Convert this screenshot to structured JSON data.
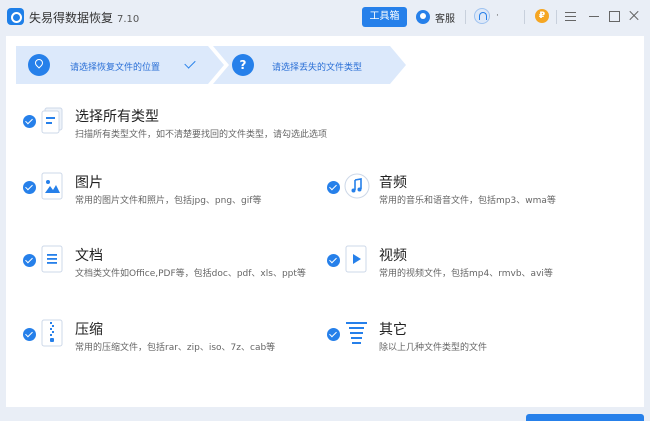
{
  "app": {
    "title": "失易得数据恢复",
    "version": "7.10"
  },
  "toolbar": {
    "toolbox_label": "工具箱",
    "service_label": "客服",
    "presence_text": "·"
  },
  "steps": [
    {
      "label": "请选择恢复文件的位置",
      "status": "done"
    },
    {
      "label": "请选择丢失的文件类型",
      "icon_text": "?"
    }
  ],
  "options": {
    "all": {
      "title": "选择所有类型",
      "desc": "扫描所有类型文件，如不清楚要找回的文件类型，请勾选此选项",
      "checked": true
    },
    "image": {
      "title": "图片",
      "desc": "常用的图片文件和照片，包括jpg、png、gif等",
      "checked": true
    },
    "audio": {
      "title": "音频",
      "desc": "常用的音乐和语音文件，包括mp3、wma等",
      "checked": true
    },
    "document": {
      "title": "文档",
      "desc": "文档类文件如Office,PDF等，包括doc、pdf、xls、ppt等",
      "checked": true
    },
    "video": {
      "title": "视频",
      "desc": "常用的视频文件，包括mp4、rmvb、avi等",
      "checked": true
    },
    "archive": {
      "title": "压缩",
      "desc": "常用的压缩文件，包括rar、zip、iso、7z、cab等",
      "checked": true
    },
    "other": {
      "title": "其它",
      "desc": "除以上几种文件类型的文件",
      "checked": true
    }
  },
  "icons": {
    "all": "file-stack-icon",
    "image": "image-file-icon",
    "audio": "music-note-icon",
    "document": "document-file-icon",
    "video": "video-play-icon",
    "archive": "zip-file-icon",
    "other": "list-file-icon"
  },
  "colors": {
    "accent": "#2680ea",
    "background": "#e9eef6",
    "step_bg": "#dce9fb",
    "coin": "#f5a623"
  }
}
